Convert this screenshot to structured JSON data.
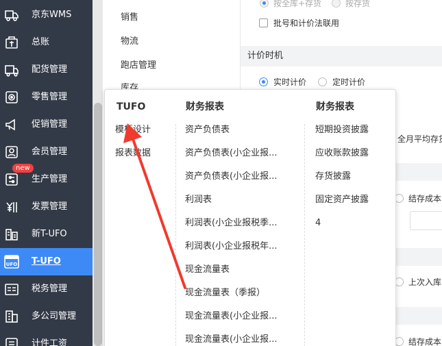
{
  "sidebar": {
    "items": [
      {
        "label": "京东WMS",
        "icon": "truck-icon"
      },
      {
        "label": "总账",
        "icon": "ledger-box-icon"
      },
      {
        "label": "配货管理",
        "icon": "distribution-truck-icon"
      },
      {
        "label": "零售管理",
        "icon": "retail-gear-icon"
      },
      {
        "label": "促销管理",
        "icon": "megaphone-icon"
      },
      {
        "label": "会员管理",
        "icon": "member-card-icon"
      },
      {
        "label": "生产管理",
        "icon": "production-sliders-icon",
        "badge": "new"
      },
      {
        "label": "发票管理",
        "icon": "invoice-yen-icon"
      },
      {
        "label": "新T-UFO",
        "icon": "building-icon"
      },
      {
        "label": "T-UFO",
        "icon": "ufo-icon",
        "active": true
      },
      {
        "label": "税务管理",
        "icon": "tax-icon"
      },
      {
        "label": "多公司管理",
        "icon": "multi-company-icon"
      },
      {
        "label": "计件工资",
        "icon": "piece-wage-icon"
      }
    ]
  },
  "submenu": {
    "items": [
      "销售",
      "物流",
      "跑店管理",
      "库存"
    ]
  },
  "settings": {
    "opt_by_all_warehouse": "按全库+存货",
    "opt_by_inventory": "按存货",
    "checkbox_batch_link": "批号和计价法联用",
    "section_pricing_time": "计价时机",
    "opt_realtime": "实时计价",
    "opt_scheduled": "定时计价",
    "text_monthly_avg": "全月平均存货",
    "text_ending_cost": "结存成本",
    "text_last_inbound": "上次入库",
    "text_ending_cost_2": "结存成本"
  },
  "popup": {
    "col1": {
      "header": "TUFO",
      "links": [
        "模板设计",
        "报表数据"
      ]
    },
    "col2": {
      "header": "财务报表",
      "links": [
        "资产负债表",
        "资产负债表(小企业报...",
        "资产负债表(小企业报...",
        "利润表",
        "利润表(小企业报税季...",
        "利润表(小企业报税年...",
        "现金流量表",
        "现金流量表（季报）",
        "现金流量表(小企业报...",
        "现金流量表(小企业报..."
      ]
    },
    "col3": {
      "header": "财务报表",
      "links": [
        "短期投资披露",
        "应收账款披露",
        "存货披露",
        "固定资产披露",
        "4"
      ]
    }
  },
  "colors": {
    "sidebar_bg": "#333a47",
    "active": "#3d8af7",
    "badge": "#f24040",
    "arrow": "#f03a2e"
  }
}
